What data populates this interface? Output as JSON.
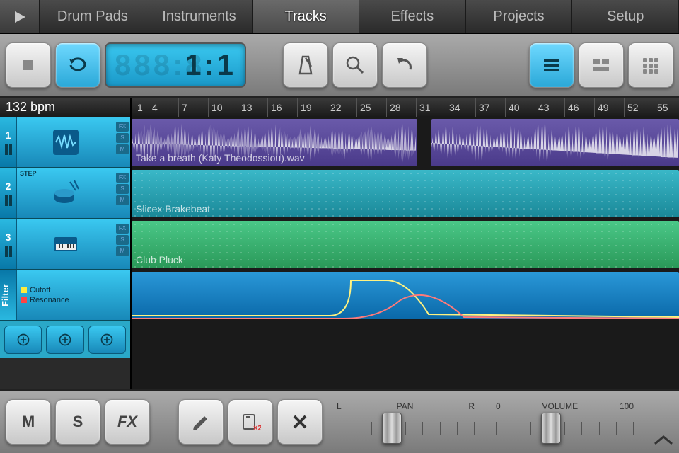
{
  "tabs": [
    "Drum Pads",
    "Instruments",
    "Tracks",
    "Effects",
    "Projects",
    "Setup"
  ],
  "active_tab": "Tracks",
  "lcd": "1:1",
  "bpm_label": "132 bpm",
  "ruler_ticks": [
    "1",
    "4",
    "7",
    "10",
    "13",
    "16",
    "19",
    "22",
    "25",
    "28",
    "31",
    "34",
    "37",
    "40",
    "43",
    "46",
    "49",
    "52",
    "55"
  ],
  "tracks": [
    {
      "num": "1",
      "step_label": "",
      "badges": [
        "FX",
        "S",
        "M"
      ],
      "clip_label": "Take a breath (Katy Theodossiou).wav"
    },
    {
      "num": "2",
      "step_label": "STEP",
      "badges": [
        "FX",
        "S",
        "M"
      ],
      "clip_label": "Slicex Brakebeat"
    },
    {
      "num": "3",
      "step_label": "",
      "badges": [
        "FX",
        "S",
        "M"
      ],
      "clip_label": "Club Pluck"
    }
  ],
  "filter": {
    "label": "Filter",
    "param1": "Cutoff",
    "param2": "Resonance"
  },
  "bottom": {
    "m": "M",
    "s": "S",
    "fx": "FX",
    "pan": {
      "left": "L",
      "label": "PAN",
      "right": "R",
      "pos_pct": 40
    },
    "vol": {
      "min": "0",
      "label": "VOLUME",
      "max": "100",
      "pos_pct": 40
    }
  }
}
